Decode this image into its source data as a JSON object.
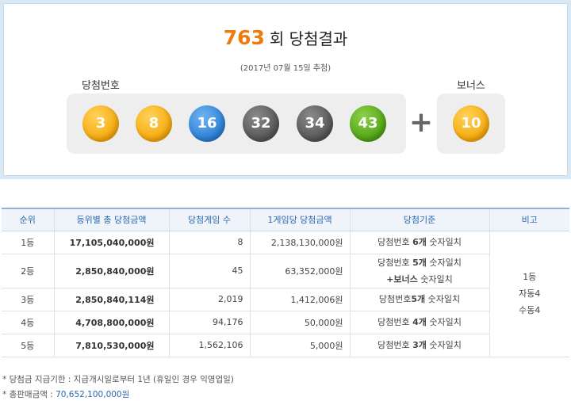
{
  "header": {
    "round_number": "763",
    "round_suffix": "회 당첨결과",
    "draw_date": "(2017년 07월 15일 추첨)",
    "main_label": "당첨번호",
    "bonus_label": "보너스",
    "plus_symbol": "+"
  },
  "balls": [
    {
      "number": "3",
      "color": "#f6a90c"
    },
    {
      "number": "8",
      "color": "#f6a90c"
    },
    {
      "number": "16",
      "color": "#2b7fd6"
    },
    {
      "number": "32",
      "color": "#555555"
    },
    {
      "number": "34",
      "color": "#555555"
    },
    {
      "number": "43",
      "color": "#50a414"
    }
  ],
  "bonus_ball": {
    "number": "10",
    "color": "#f6a90c"
  },
  "table": {
    "headers": [
      "순위",
      "등위별 총 당첨금액",
      "당첨게임 수",
      "1게임당 당첨금액",
      "당첨기준",
      "비고"
    ],
    "rows": [
      {
        "rank": "1등",
        "total": "17,105,040,000원",
        "winners": "8",
        "per_game": "2,138,130,000원",
        "crit_a": "당첨번호 ",
        "crit_bold": "6개",
        "crit_b": " 숫자일치",
        "crit_line2": ""
      },
      {
        "rank": "2등",
        "total": "2,850,840,000원",
        "winners": "45",
        "per_game": "63,352,000원",
        "crit_a": "당첨번호 ",
        "crit_bold": "5개",
        "crit_b": " 숫자일치",
        "crit_line2_bold": "+보너스",
        "crit_line2": " 숫자일치"
      },
      {
        "rank": "3등",
        "total": "2,850,840,114원",
        "winners": "2,019",
        "per_game": "1,412,006원",
        "crit_a": "당첨번호",
        "crit_bold": "5개",
        "crit_b": " 숫자일치",
        "crit_line2": ""
      },
      {
        "rank": "4등",
        "total": "4,708,800,000원",
        "winners": "94,176",
        "per_game": "50,000원",
        "crit_a": "당첨번호 ",
        "crit_bold": "4개",
        "crit_b": " 숫자일치",
        "crit_line2": ""
      },
      {
        "rank": "5등",
        "total": "7,810,530,000원",
        "winners": "1,562,106",
        "per_game": "5,000원",
        "crit_a": "당첨번호 ",
        "crit_bold": "3개",
        "crit_b": " 숫자일치",
        "crit_line2": ""
      }
    ],
    "note_lines": [
      "1등",
      "자동4",
      "수동4"
    ]
  },
  "footnotes": {
    "payment_period": "* 당첨금 지급기한 : 지급개시일로부터 1년 (휴일인 경우 익영업일)",
    "total_sales_label": "* 총판매금액 : ",
    "total_sales_value": "70,652,100,000원"
  }
}
